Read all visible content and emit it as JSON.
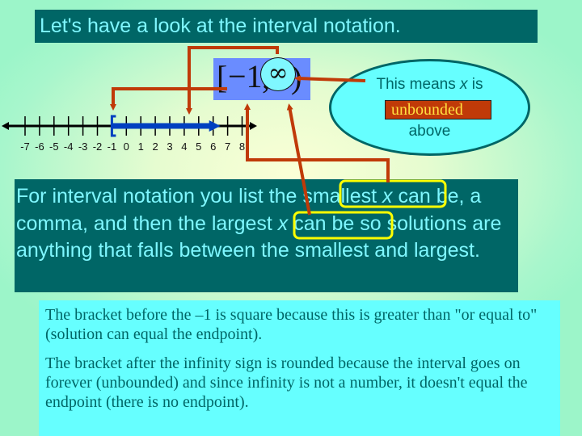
{
  "title": "Let's have a look at the interval notation.",
  "notation": {
    "left_bracket": "[",
    "left_value": "−1",
    "comma": ",",
    "right_value": "∞",
    "right_bracket": ")"
  },
  "callout": {
    "line1_pre": "This means ",
    "line1_var": "x",
    "line1_post": " is",
    "highlight": "unbounded",
    "line3": "above"
  },
  "number_line": {
    "ticks": [
      -7,
      -6,
      -5,
      -4,
      -3,
      -2,
      -1,
      0,
      1,
      2,
      3,
      4,
      5,
      6,
      7,
      8
    ],
    "shaded_from": -1,
    "endpoint_style": "closed-bracket",
    "direction": "right"
  },
  "explanation": {
    "part1": "For interval notation you list the ",
    "smallest": "smallest ",
    "smallest_var": "x",
    "part2": " can be, a comma, and then the ",
    "largest": "largest ",
    "largest_var": "x",
    "part3": " can be so solutions are anything that falls between the smallest and largest."
  },
  "notes": [
    "The bracket before the –1 is square because this is greater than \"or equal to\" (solution can equal the endpoint).",
    "The bracket after the infinity sign is rounded because the interval goes on forever (unbounded) and since infinity is not a number, it doesn't equal the endpoint (there is no endpoint)."
  ],
  "colors": {
    "title_bg": "#006666",
    "title_text": "#7ff7ff",
    "arrow": "#c03a08",
    "highlight_box": "#ffff00",
    "interval_fill": "#0040c0",
    "notation_bg": "#6a8cff",
    "callout_bg": "#66ffff"
  }
}
